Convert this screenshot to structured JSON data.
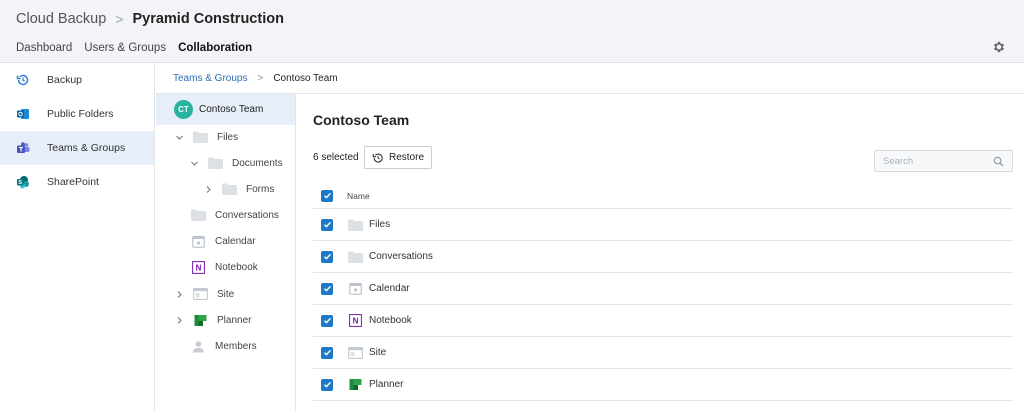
{
  "header": {
    "app_title": "Cloud Backup",
    "separator": ">",
    "org_name": "Pyramid Construction",
    "nav": [
      {
        "label": "Dashboard",
        "active": false
      },
      {
        "label": "Users & Groups",
        "active": false
      },
      {
        "label": "Collaboration",
        "active": true
      }
    ],
    "settings_icon": "gear-icon"
  },
  "sidebar": {
    "items": [
      {
        "label": "Backup",
        "icon": "history-icon",
        "active": false
      },
      {
        "label": "Public Folders",
        "icon": "outlook-icon",
        "active": false
      },
      {
        "label": "Teams & Groups",
        "icon": "teams-icon",
        "active": true
      },
      {
        "label": "SharePoint",
        "icon": "sharepoint-icon",
        "active": false
      }
    ]
  },
  "breadcrumb": {
    "parent": "Teams & Groups",
    "separator": ">",
    "current": "Contoso Team"
  },
  "tree": {
    "root": {
      "avatar": "CT",
      "label": "Contoso Team"
    },
    "items": [
      {
        "label": "Files",
        "icon": "folder-icon",
        "expander": "chevron-down-icon"
      },
      {
        "label": "Documents",
        "icon": "folder-icon",
        "expander": "chevron-down-icon"
      },
      {
        "label": "Forms",
        "icon": "folder-icon",
        "expander": "chevron-right-icon"
      },
      {
        "label": "Conversations",
        "icon": "folder-icon",
        "expander": ""
      },
      {
        "label": "Calendar",
        "icon": "calendar-icon",
        "expander": ""
      },
      {
        "label": "Notebook",
        "icon": "onenote-icon",
        "expander": ""
      },
      {
        "label": "Site",
        "icon": "site-icon",
        "expander": "chevron-right-icon"
      },
      {
        "label": "Planner",
        "icon": "planner-icon",
        "expander": "chevron-right-icon"
      },
      {
        "label": "Members",
        "icon": "person-icon",
        "expander": ""
      }
    ]
  },
  "main": {
    "title": "Contoso Team",
    "selected_count": "6 selected",
    "restore_label": "Restore",
    "search_placeholder": "Search",
    "table": {
      "column_name": "Name",
      "rows": [
        {
          "label": "Files",
          "icon": "folder-icon",
          "checked": true
        },
        {
          "label": "Conversations",
          "icon": "folder-icon",
          "checked": true
        },
        {
          "label": "Calendar",
          "icon": "calendar-icon",
          "checked": true
        },
        {
          "label": "Notebook",
          "icon": "onenote-icon",
          "checked": true
        },
        {
          "label": "Site",
          "icon": "site-icon",
          "checked": true
        },
        {
          "label": "Planner",
          "icon": "planner-icon",
          "checked": true
        }
      ]
    }
  },
  "colors": {
    "accent_blue": "#1e78c8",
    "link_blue": "#2f6fb5",
    "active_bg": "#e6eef7",
    "avatar_teal": "#27b39e",
    "folder_grey": "#dde1e6",
    "planner_green": "#31a24c"
  }
}
